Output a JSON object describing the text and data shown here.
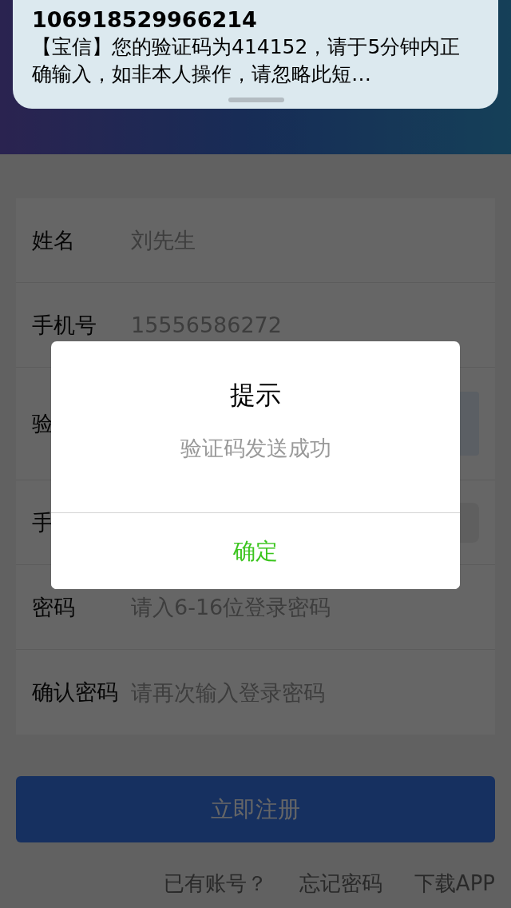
{
  "notification": {
    "sender": "106918529966214",
    "message": "【宝信】您的验证码为414152，请于5分钟内正确输入，如非本人操作，请忽略此短…"
  },
  "form": {
    "fields": [
      {
        "kind": "text",
        "label": "姓名",
        "placeholder": "刘先生"
      },
      {
        "kind": "text",
        "label": "手机号",
        "placeholder": "15556586272"
      },
      {
        "kind": "code",
        "label": "验"
      },
      {
        "kind": "select",
        "label": "手"
      },
      {
        "kind": "text",
        "label": "密码",
        "placeholder": "请入6-16位登录密码"
      },
      {
        "kind": "text",
        "label": "确认密码",
        "placeholder": "请再次输入登录密码"
      }
    ]
  },
  "submit_button": "立即注册",
  "links": [
    "已有账号？",
    "忘记密码",
    "下载APP"
  ],
  "dialog": {
    "title": "提示",
    "message": "验证码发送成功",
    "button": "确定"
  }
}
